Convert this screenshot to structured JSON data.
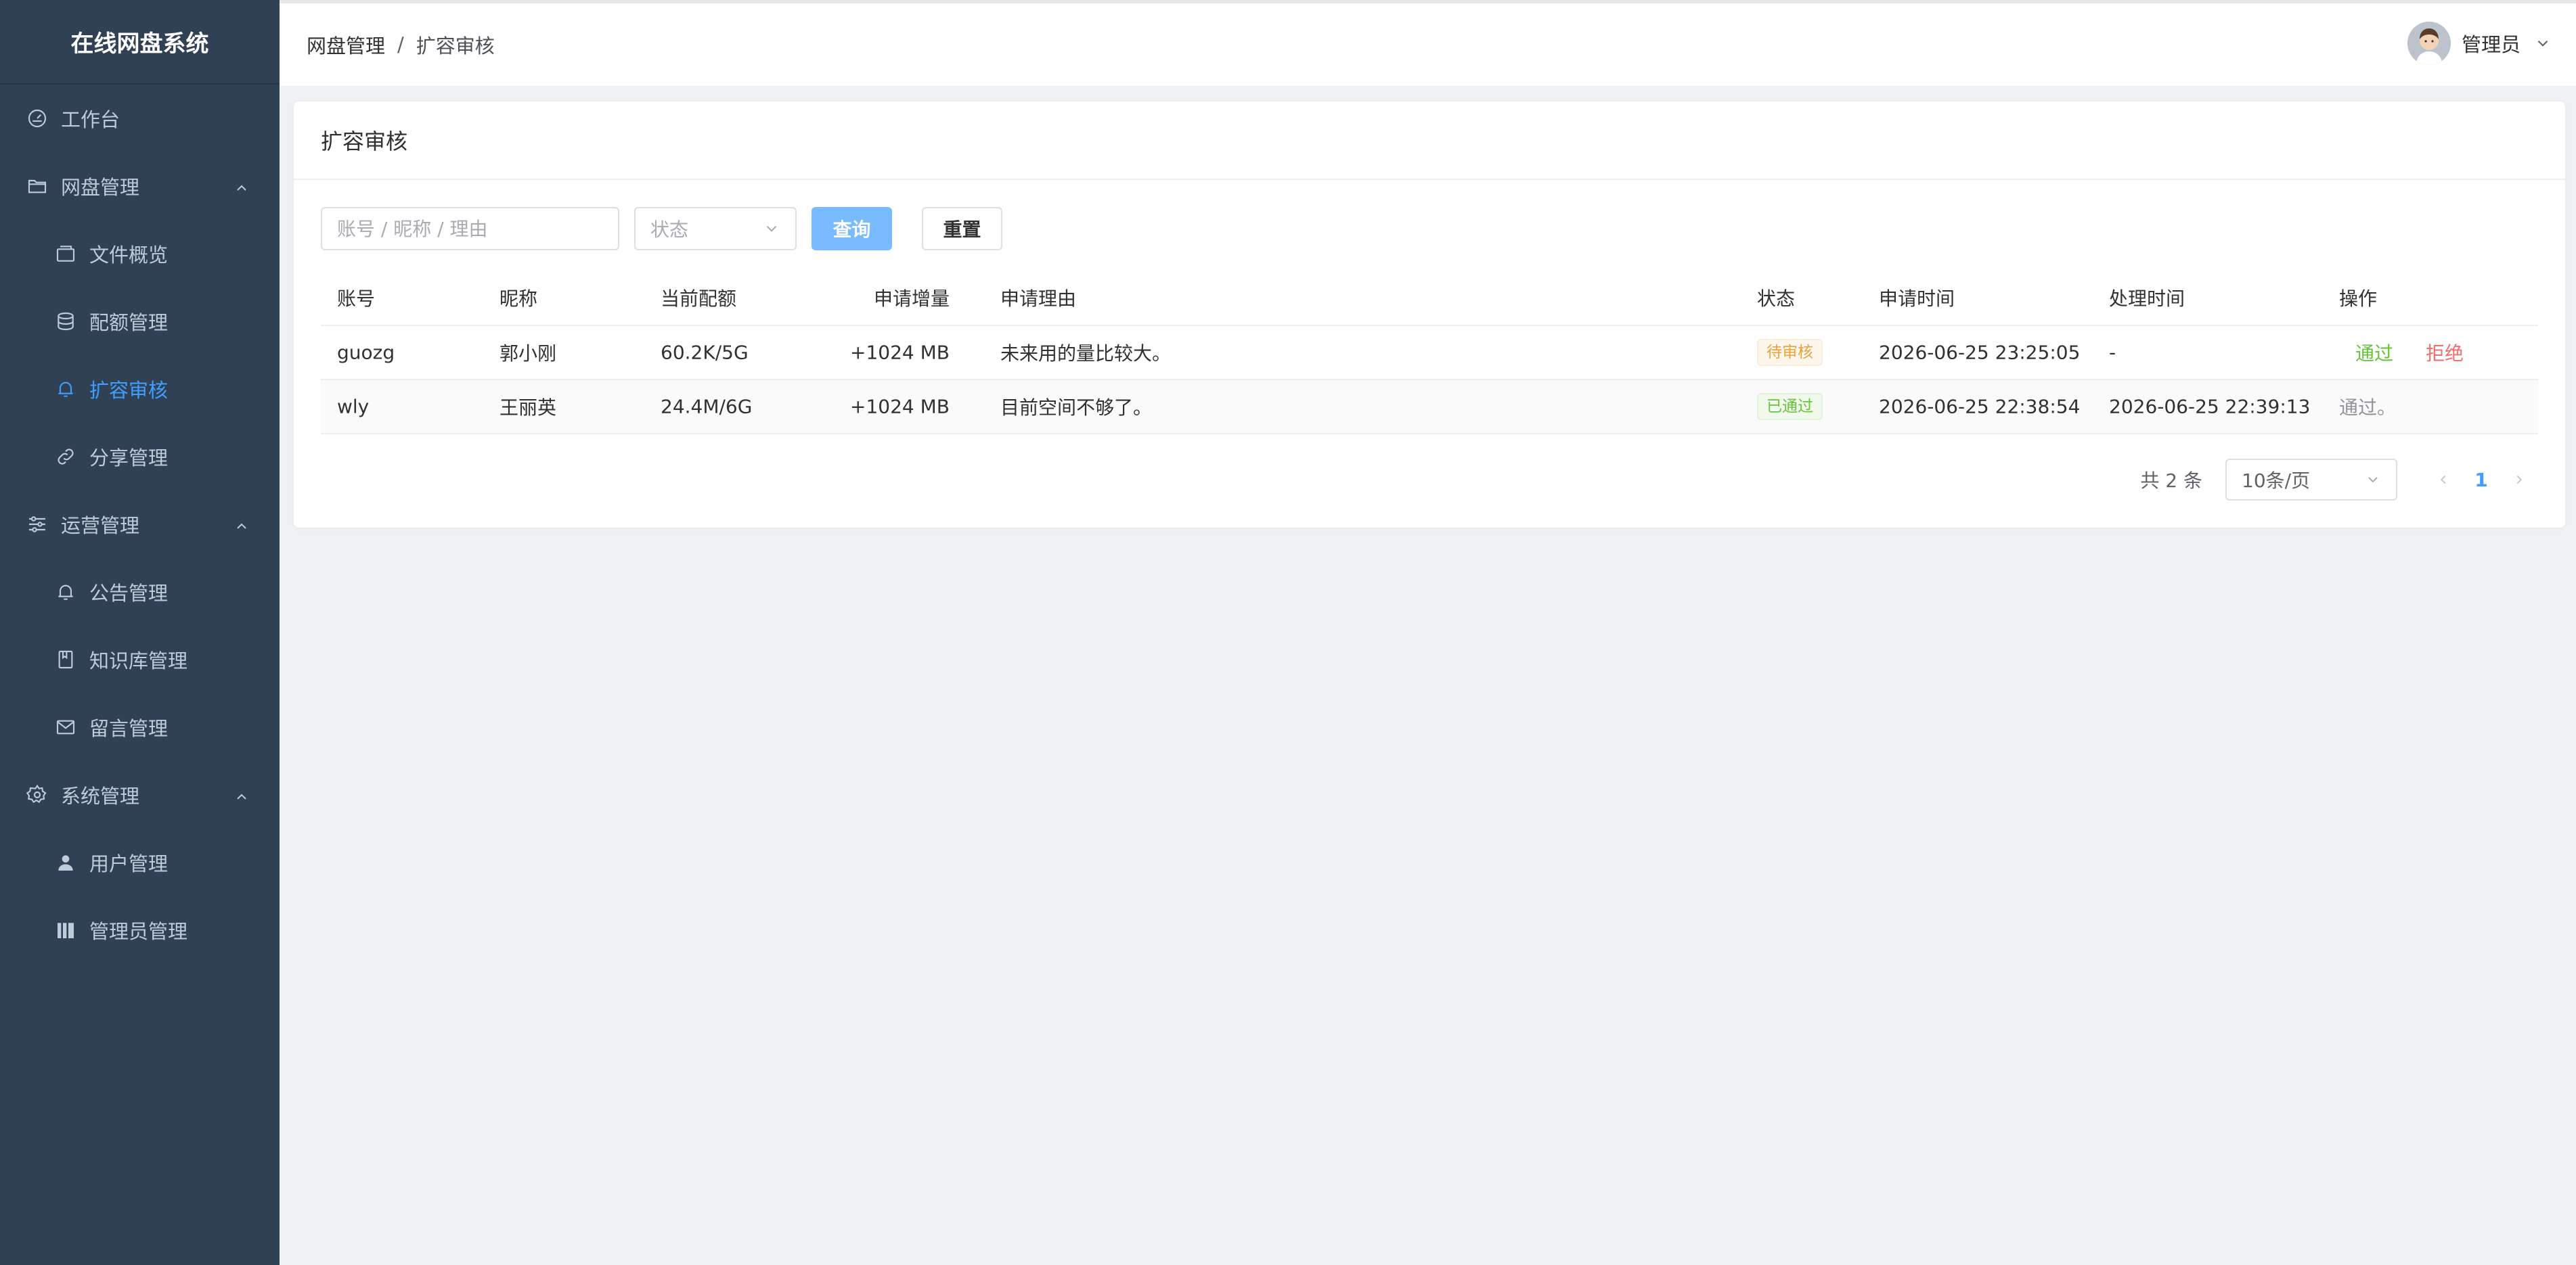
{
  "app": {
    "title": "在线网盘系统"
  },
  "sidebar": {
    "items": [
      {
        "label": "工作台",
        "icon": "dashboard-icon",
        "level": 1
      },
      {
        "label": "网盘管理",
        "icon": "folder-icon",
        "level": 1,
        "expanded": true
      },
      {
        "label": "文件概览",
        "icon": "files-icon",
        "level": 2
      },
      {
        "label": "配额管理",
        "icon": "database-icon",
        "level": 2
      },
      {
        "label": "扩容审核",
        "icon": "bell-icon",
        "level": 2,
        "active": true
      },
      {
        "label": "分享管理",
        "icon": "link-icon",
        "level": 2
      },
      {
        "label": "运营管理",
        "icon": "sliders-icon",
        "level": 1,
        "expanded": true
      },
      {
        "label": "公告管理",
        "icon": "bell-icon",
        "level": 2
      },
      {
        "label": "知识库管理",
        "icon": "book-icon",
        "level": 2
      },
      {
        "label": "留言管理",
        "icon": "message-icon",
        "level": 2
      },
      {
        "label": "系统管理",
        "icon": "gear-icon",
        "level": 1,
        "expanded": true
      },
      {
        "label": "用户管理",
        "icon": "user-icon",
        "level": 2
      },
      {
        "label": "管理员管理",
        "icon": "admin-icon",
        "level": 2
      }
    ]
  },
  "header": {
    "breadcrumb": [
      "网盘管理",
      "扩容审核"
    ],
    "breadcrumb_sep": "/",
    "user_name": "管理员"
  },
  "card": {
    "title": "扩容审核"
  },
  "filters": {
    "search_placeholder": "账号 / 昵称 / 理由",
    "status_placeholder": "状态",
    "query_label": "查询",
    "reset_label": "重置"
  },
  "table": {
    "columns": {
      "account": "账号",
      "nickname": "昵称",
      "quota": "当前配额",
      "increase": "申请增量",
      "reason": "申请理由",
      "status": "状态",
      "apply_time": "申请时间",
      "handle_time": "处理时间",
      "ops": "操作"
    },
    "rows": [
      {
        "account": "guozg",
        "nickname": "郭小刚",
        "quota": "60.2K/5G",
        "increase": "+1024 MB",
        "reason": "未来用的量比较大。",
        "status": "待审核",
        "apply_time": "2026-06-25 23:25:05",
        "handle_time": "-",
        "op_pass": "通过",
        "op_reject": "拒绝"
      },
      {
        "account": "wly",
        "nickname": "王丽英",
        "quota": "24.4M/6G",
        "increase": "+1024 MB",
        "reason": "目前空间不够了。",
        "status": "已通过",
        "apply_time": "2026-06-25 22:38:54",
        "handle_time": "2026-06-25 22:39:13",
        "op_note": "通过。"
      }
    ]
  },
  "pagination": {
    "total": "共 2 条",
    "page_size": "10条/页",
    "current_page": "1"
  },
  "colors": {
    "sidebar_bg": "#304156",
    "accent": "#409eff",
    "success": "#67c23a",
    "danger": "#f56c6c",
    "warning": "#e6a23c"
  }
}
